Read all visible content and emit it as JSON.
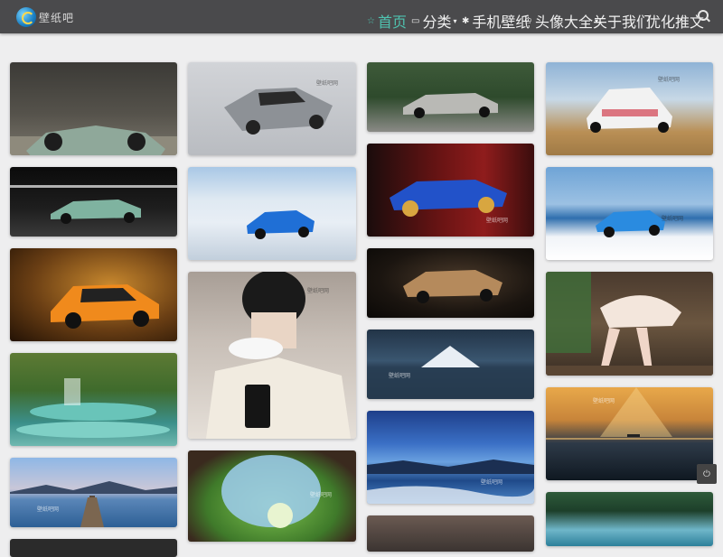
{
  "header": {
    "logo_text": "壁纸吧",
    "nav": [
      {
        "label": "首页",
        "icon": "☆",
        "active": true
      },
      {
        "label": "分类",
        "icon": "▭",
        "caret": true
      },
      {
        "label": "手机壁纸",
        "icon": "✱"
      },
      {
        "label": "头像大全",
        "icon": "♔",
        "caret": true
      },
      {
        "label": "关于我们"
      },
      {
        "label": "优化推文"
      }
    ]
  },
  "watermark": "壁纸吧网",
  "gallery": [
    {
      "subject": "green concept sports car",
      "col": 0
    },
    {
      "subject": "silver ferrari sports car",
      "col": 1
    },
    {
      "subject": "open roadster on forest road",
      "col": 2
    },
    {
      "subject": "white supercar desert",
      "col": 3
    },
    {
      "subject": "green race car studio",
      "col": 0
    },
    {
      "subject": "blue sports car on ice",
      "col": 1
    },
    {
      "subject": "blue roadster red studio",
      "col": 2
    },
    {
      "subject": "blue car snowy shore",
      "col": 3
    },
    {
      "subject": "orange mclaren sports car",
      "col": 0
    },
    {
      "subject": "couple nurse hat selfie",
      "col": 1
    },
    {
      "subject": "gold hypercar dark studio",
      "col": 2
    },
    {
      "subject": "legs by window anime",
      "col": 3
    },
    {
      "subject": "turquoise waterfall terraces",
      "col": 0
    },
    {
      "subject": "mountain lake at dusk",
      "col": 2
    },
    {
      "subject": "sunset sea clouds",
      "col": 3
    },
    {
      "subject": "lake pier at dusk",
      "col": 0
    },
    {
      "subject": "tunnel railway anime scene",
      "col": 1
    },
    {
      "subject": "anime night sky beach",
      "col": 2
    },
    {
      "subject": "lake with trees",
      "col": 3
    }
  ]
}
